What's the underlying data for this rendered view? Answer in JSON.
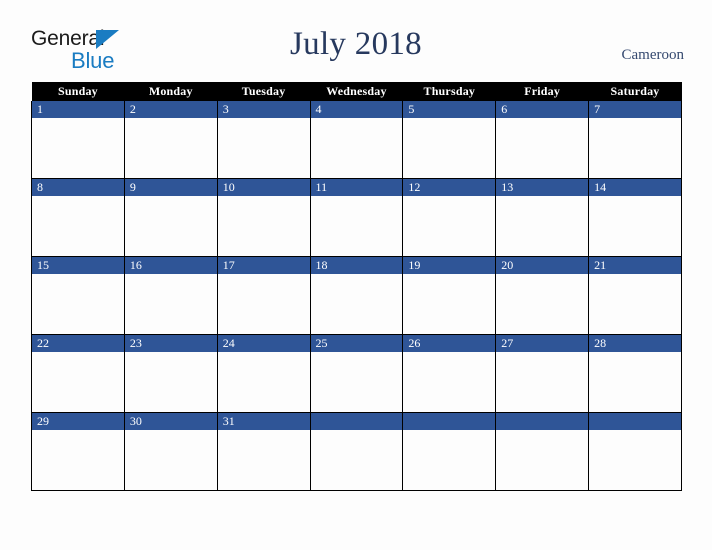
{
  "brand": {
    "name_part1": "General",
    "name_part2": "Blue",
    "triangle_icon": "blue-triangle-icon",
    "accent_color": "#1a7cc2"
  },
  "header": {
    "title": "July 2018",
    "month": "July",
    "year": "2018",
    "country": "Cameroon",
    "title_color": "#27395e",
    "country_color": "#35496f"
  },
  "calendar": {
    "weekday_headers": [
      "Sunday",
      "Monday",
      "Tuesday",
      "Wednesday",
      "Thursday",
      "Friday",
      "Saturday"
    ],
    "header_bg": "#000000",
    "header_text_color": "#ffffff",
    "day_band_color": "#2f5597",
    "day_number_color": "#ffffff",
    "cell_bg": "#fdfdfd",
    "grid_line_color": "#000000",
    "weeks": [
      {
        "days": [
          "1",
          "2",
          "3",
          "4",
          "5",
          "6",
          "7"
        ]
      },
      {
        "days": [
          "8",
          "9",
          "10",
          "11",
          "12",
          "13",
          "14"
        ]
      },
      {
        "days": [
          "15",
          "16",
          "17",
          "18",
          "19",
          "20",
          "21"
        ]
      },
      {
        "days": [
          "22",
          "23",
          "24",
          "25",
          "26",
          "27",
          "28"
        ]
      },
      {
        "days": [
          "29",
          "30",
          "31",
          "",
          "",
          "",
          ""
        ]
      }
    ]
  }
}
